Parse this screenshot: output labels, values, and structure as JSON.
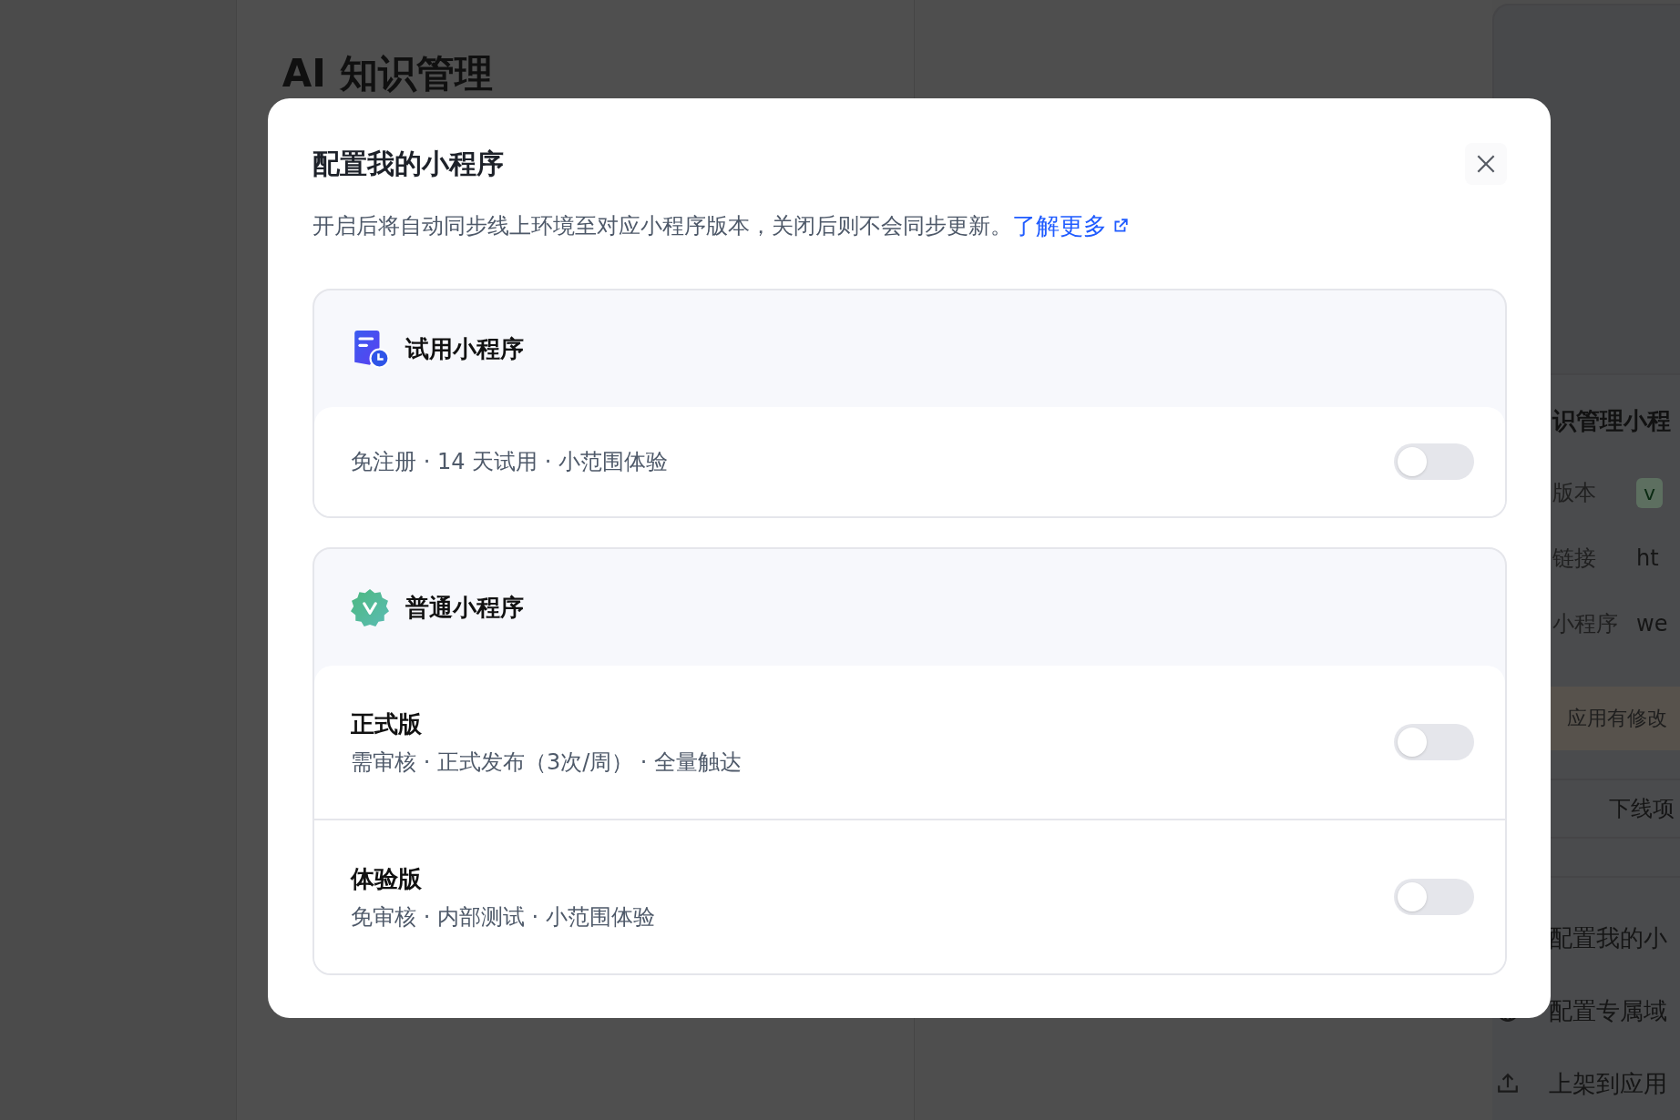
{
  "background": {
    "page_title": "AI 知识管理",
    "panel": {
      "title": "识管理小程",
      "fields": [
        {
          "label": "版本",
          "value": "v",
          "kind": "badge"
        },
        {
          "label": "链接",
          "value": "ht",
          "kind": "text"
        },
        {
          "label": "小程序",
          "value": "we",
          "kind": "text"
        }
      ],
      "notice": "应用有修改",
      "offline_button": "下线项",
      "actions": [
        {
          "label": "配置我的小"
        },
        {
          "label": "配置专属域"
        },
        {
          "label": "上架到应用"
        }
      ]
    }
  },
  "dialog": {
    "title": "配置我的小程序",
    "description": "开启后将自动同步线上环境至对应小程序版本，关闭后则不会同步更新。",
    "link": "了解更多",
    "groups": [
      {
        "title": "试用小程序",
        "options": [
          {
            "description": "免注册 · 14 天试用 · 小范围体验",
            "on": false
          }
        ]
      },
      {
        "title": "普通小程序",
        "options": [
          {
            "label": "正式版",
            "description": "需审核 · 正式发布（3次/周） · 全量触达",
            "on": false
          },
          {
            "label": "体验版",
            "description": "免审核 · 内部测试 · 小范围体验",
            "on": false
          }
        ]
      }
    ]
  }
}
